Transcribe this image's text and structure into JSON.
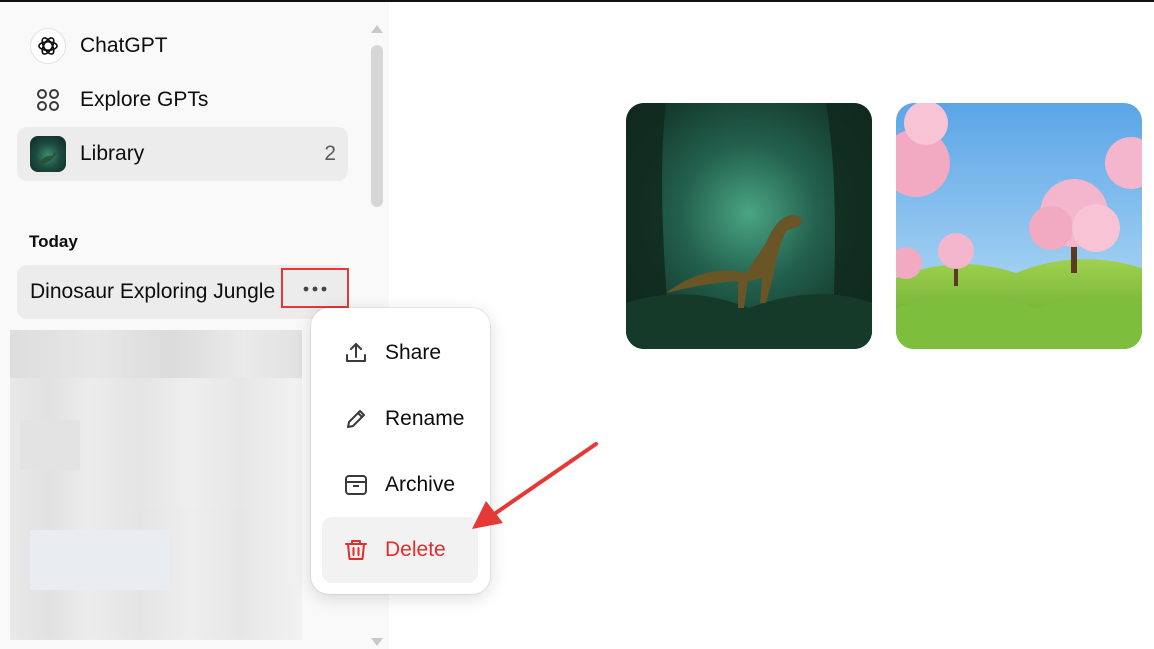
{
  "sidebar": {
    "nav": [
      {
        "label": "ChatGPT",
        "icon": "openai-logo-icon"
      },
      {
        "label": "Explore GPTs",
        "icon": "grid-icon"
      },
      {
        "label": "Library",
        "icon": "library-thumbnail",
        "count": "2"
      }
    ],
    "section_label": "Today",
    "chat_title": "Dinosaur Exploring Jungle",
    "more_icon": "ellipsis-icon"
  },
  "context_menu": {
    "items": [
      {
        "label": "Share",
        "icon": "share-upload-icon"
      },
      {
        "label": "Rename",
        "icon": "pencil-icon"
      },
      {
        "label": "Archive",
        "icon": "archive-box-icon"
      },
      {
        "label": "Delete",
        "icon": "trash-icon"
      }
    ]
  },
  "gallery": {
    "images": [
      {
        "name": "dinosaur-jungle-image"
      },
      {
        "name": "cherry-blossom-hills-image"
      }
    ]
  },
  "colors": {
    "highlight_red": "#e53935",
    "delete_red": "#e02e2a",
    "sidebar_bg": "#f9f9f9",
    "active_bg": "#ececec"
  }
}
